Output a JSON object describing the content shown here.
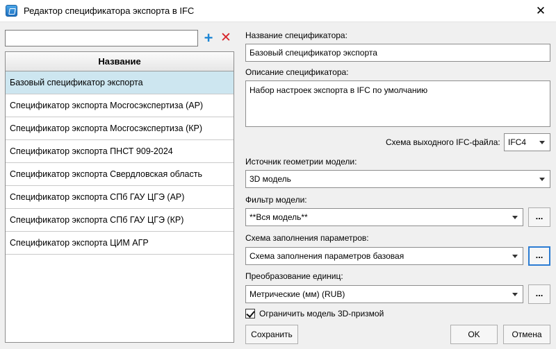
{
  "window": {
    "title": "Редактор спецификатора экспорта в IFC"
  },
  "left": {
    "search_value": "",
    "table_header": "Название",
    "items": [
      "Базовый спецификатор экспорта",
      "Спецификатор экспорта Мосгосэкспертиза (АР)",
      "Спецификатор экспорта Мосгосэкспертиза (КР)",
      "Спецификатор экспорта ПНСТ 909-2024",
      "Спецификатор экспорта Свердловская область",
      "Спецификатор экспорта СПб ГАУ ЦГЭ (АР)",
      "Спецификатор экспорта СПб ГАУ ЦГЭ (КР)",
      "Спецификатор экспорта ЦИМ АГР"
    ],
    "selected_index": 0
  },
  "right": {
    "name_label": "Название спецификатора:",
    "name_value": "Базовый спецификатор экспорта",
    "description_label": "Описание спецификатора:",
    "description_value": "Набор настроек экспорта в IFC по умолчанию",
    "schema_label": "Схема выходного IFC-файла:",
    "schema_value": "IFC4",
    "geometry_label": "Источник геометрии модели:",
    "geometry_value": "3D модель",
    "filter_label": "Фильтр модели:",
    "filter_value": "**Вся модель**",
    "params_label": "Схема заполнения параметров:",
    "params_value": "Схема заполнения параметров базовая",
    "units_label": "Преобразование единиц:",
    "units_value": "Метрические (мм) (RUB)",
    "ellipsis_label": "...",
    "limit_checkbox_label": "Ограничить модель 3D-призмой",
    "limit_checked": true
  },
  "buttons": {
    "save": "Сохранить",
    "ok": "OK",
    "cancel": "Отмена"
  },
  "icons": {
    "add": "plus-icon",
    "remove": "close-icon",
    "app": "ifc-app-icon"
  },
  "colors": {
    "accent": "#1e86d4",
    "danger": "#d7262b",
    "selection": "#cde6f0"
  }
}
